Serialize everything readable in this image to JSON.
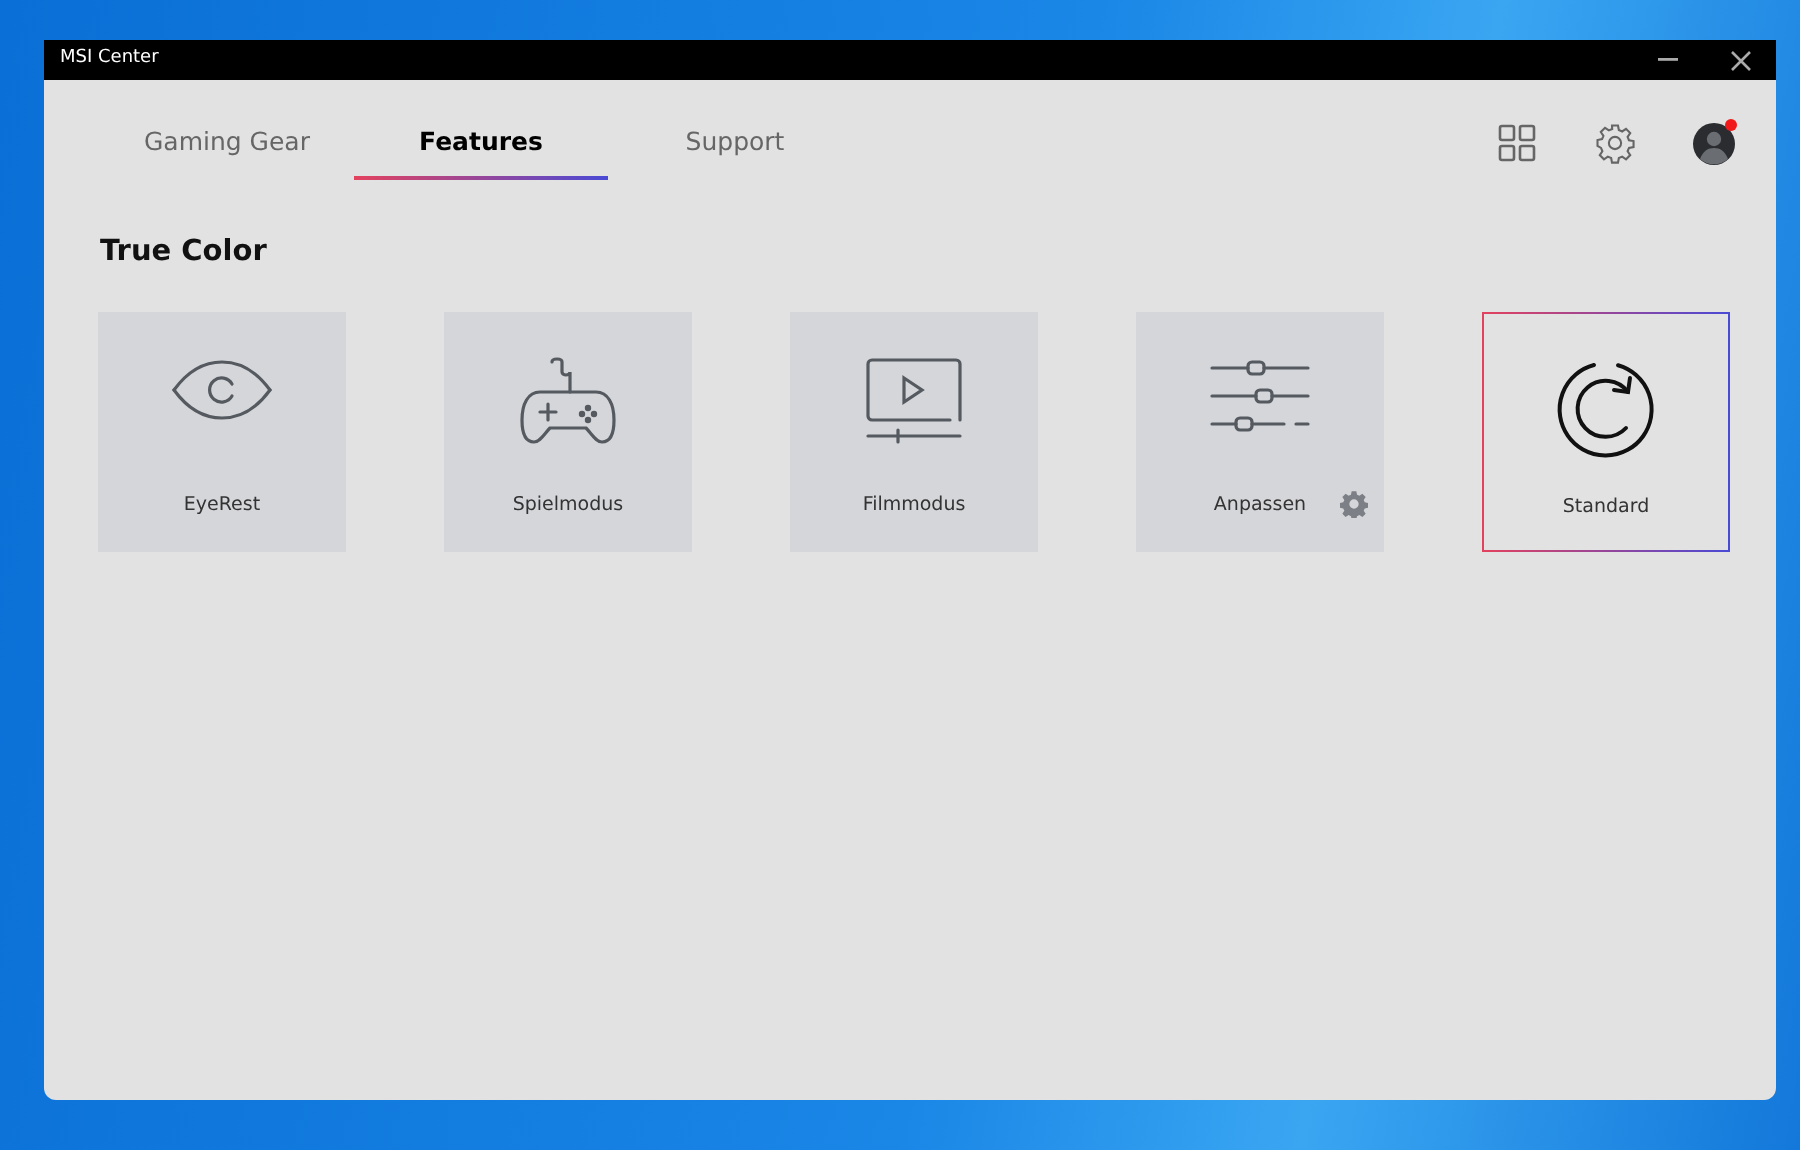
{
  "window": {
    "title": "MSI Center"
  },
  "tabs": [
    {
      "label": "Gaming Gear",
      "selected": false
    },
    {
      "label": "Features",
      "selected": true
    },
    {
      "label": "Support",
      "selected": false
    }
  ],
  "section": {
    "title": "True Color"
  },
  "modes": [
    {
      "label": "EyeRest",
      "kind": "eye",
      "selected": false,
      "has_settings": false
    },
    {
      "label": "Spielmodus",
      "kind": "gamepad",
      "selected": false,
      "has_settings": false
    },
    {
      "label": "Filmmodus",
      "kind": "film",
      "selected": false,
      "has_settings": false
    },
    {
      "label": "Anpassen",
      "kind": "sliders",
      "selected": false,
      "has_settings": true
    },
    {
      "label": "Standard",
      "kind": "reset",
      "selected": true,
      "has_settings": false
    }
  ]
}
